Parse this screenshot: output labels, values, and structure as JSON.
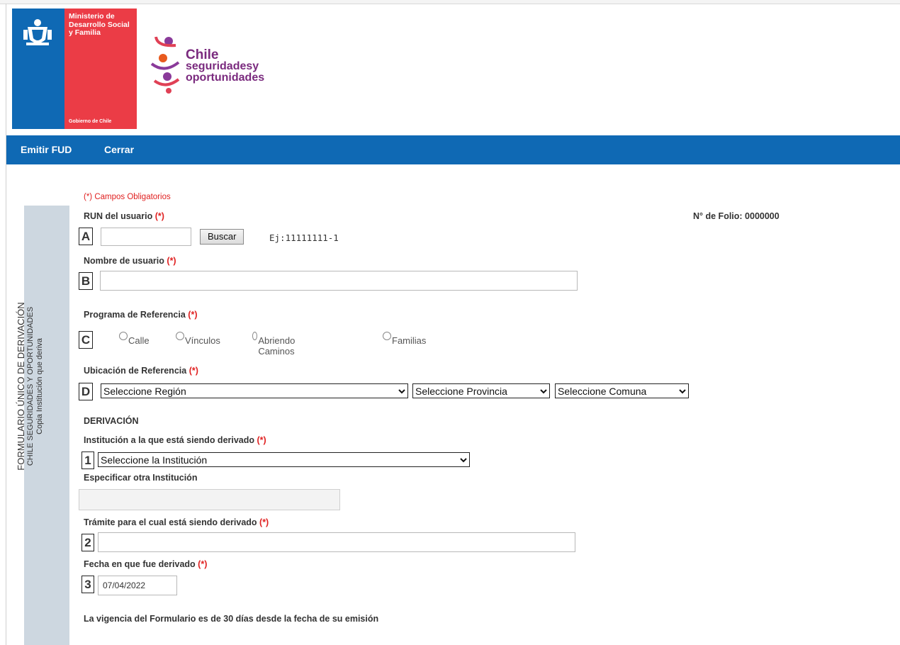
{
  "header": {
    "gob_logo_text": "Ministerio de Desarrollo Social y Familia",
    "gob_logo_footer": "Gobierno de Chile",
    "chile_logo_line1": "Chile",
    "chile_logo_line2": "seguridadesy",
    "chile_logo_line3": "oportunidades"
  },
  "menu": {
    "items": [
      {
        "label": "Emitir FUD"
      },
      {
        "label": "Cerrar"
      }
    ]
  },
  "sidebar": {
    "title": "FORMULARIO ÚNICO DE DERIVACIÓN",
    "subtitle": "CHILE SEGURIDADES Y OPORTUNIDADES",
    "copy": "Copia Institución que deriva"
  },
  "form": {
    "required_note": "(*) Campos Obligatorios",
    "required_mark": "(*)",
    "folio": "N° de Folio: 0000000",
    "run": {
      "label": "RUN del usuario",
      "marker": "A",
      "value": "",
      "button": "Buscar",
      "hint": "Ej:11111111-1"
    },
    "nombre": {
      "label": "Nombre de usuario",
      "marker": "B",
      "value": ""
    },
    "programa": {
      "label": "Programa de Referencia",
      "marker": "C",
      "options": [
        "Calle",
        "Vínculos",
        "Abriendo Caminos",
        "Familias"
      ]
    },
    "ubicacion": {
      "label": "Ubicación de Referencia",
      "marker": "D",
      "region": "Seleccione Región",
      "provincia": "Seleccione Provincia",
      "comuna": "Seleccione Comuna"
    },
    "derivacion_title": "DERIVACIÓN",
    "institucion": {
      "label": "Institución a la que está siendo derivado",
      "marker": "1",
      "value": "Seleccione la Institución"
    },
    "otra_institucion": {
      "label": "Especificar otra Institución",
      "value": ""
    },
    "tramite": {
      "label": "Trámite para el cual está siendo derivado",
      "marker": "2",
      "value": ""
    },
    "fecha": {
      "label": "Fecha en que fue derivado",
      "marker": "3",
      "value": "07/04/2022"
    },
    "vigencia": "La vigencia del Formulario es de 30 días desde la fecha de su emisión"
  },
  "colors": {
    "brand_blue": "#0f69b4",
    "brand_red": "#eb3c46",
    "required_red": "#e02020",
    "side_band": "#cdd7e0"
  }
}
